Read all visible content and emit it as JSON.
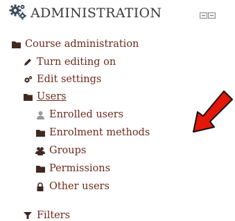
{
  "block": {
    "title": "ADMINISTRATION",
    "icon": "gears-icon"
  },
  "tree": [
    {
      "label": "Course administration",
      "icon": "folder-icon"
    },
    {
      "label": "Turn editing on",
      "icon": "pencil-icon"
    },
    {
      "label": "Edit settings",
      "icon": "cog-icon"
    },
    {
      "label": "Users",
      "icon": "folder-icon",
      "underlined": true
    },
    {
      "label": "Enrolled users",
      "icon": "user-icon"
    },
    {
      "label": "Enrolment methods",
      "icon": "folder-icon"
    },
    {
      "label": "Groups",
      "icon": "users-icon"
    },
    {
      "label": "Permissions",
      "icon": "folder-icon"
    },
    {
      "label": "Other users",
      "icon": "lock-icon"
    },
    {
      "label": "Filters",
      "icon": "filter-icon"
    }
  ],
  "colors": {
    "link": "#6a2a1c",
    "icon_dark": "#3f2a22",
    "arrow_fill": "#e3170a",
    "arrow_stroke": "#111111"
  }
}
